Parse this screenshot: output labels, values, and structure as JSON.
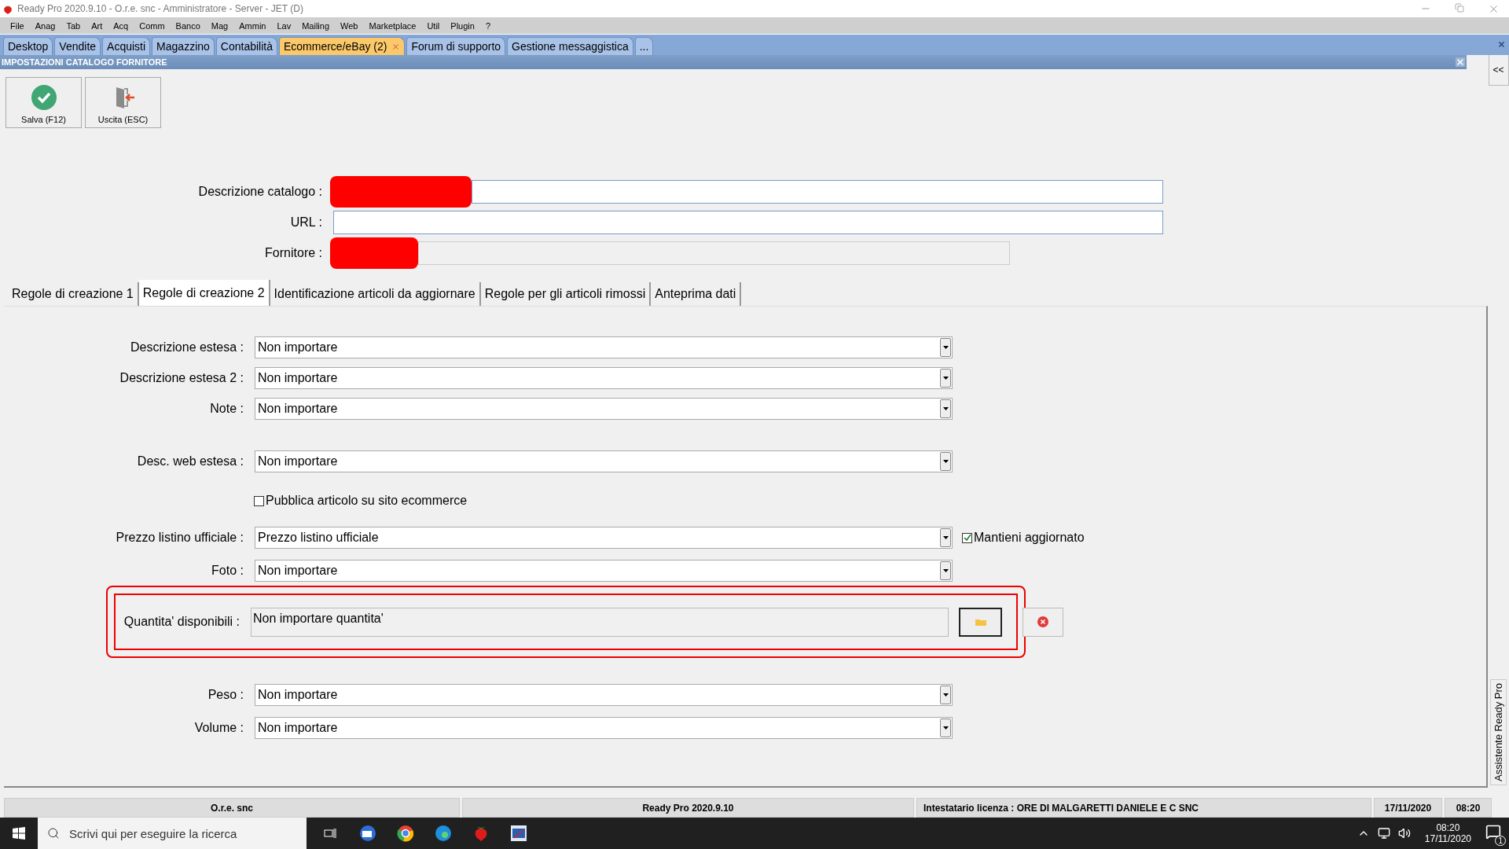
{
  "window": {
    "title": "Ready Pro 2020.9.10 - O.r.e. snc - Amministratore - Server - JET (D)"
  },
  "menu": [
    "File",
    "Anag",
    "Tab",
    "Art",
    "Acq",
    "Comm",
    "Banco",
    "Mag",
    "Ammin",
    "Lav",
    "Mailing",
    "Web",
    "Marketplace",
    "Util",
    "Plugin",
    "?"
  ],
  "app_tabs": [
    {
      "label": "Desktop",
      "selected": false,
      "closable": false
    },
    {
      "label": "Vendite",
      "selected": false,
      "closable": false
    },
    {
      "label": "Acquisti",
      "selected": false,
      "closable": false
    },
    {
      "label": "Magazzino",
      "selected": false,
      "closable": false
    },
    {
      "label": "Contabilità",
      "selected": false,
      "closable": false
    },
    {
      "label": "Ecommerce/eBay (2)",
      "selected": true,
      "closable": true
    },
    {
      "label": "Forum di supporto",
      "selected": false,
      "closable": false
    },
    {
      "label": "Gestione messaggistica",
      "selected": false,
      "closable": false
    },
    {
      "label": "...",
      "selected": false,
      "closable": false
    }
  ],
  "section": {
    "title": "IMPOSTAZIONI CATALOGO FORNITORE"
  },
  "toolbar": [
    {
      "kind": "save",
      "label": "Salva (F12)"
    },
    {
      "kind": "exit",
      "label": "Uscita (ESC)"
    }
  ],
  "header_fields": [
    {
      "kind": "text",
      "label": "Descrizione catalogo :",
      "redacted": true
    },
    {
      "kind": "text",
      "label": "URL :",
      "redacted": false
    },
    {
      "kind": "readonly",
      "label": "Fornitore :",
      "redacted": true
    }
  ],
  "tabs": [
    {
      "label": "Regole di creazione 1",
      "selected": false
    },
    {
      "label": "Regole di creazione 2",
      "selected": true
    },
    {
      "label": "Identificazione articoli da aggiornare",
      "selected": false
    },
    {
      "label": "Regole per gli articoli rimossi",
      "selected": false
    },
    {
      "label": "Anteprima dati",
      "selected": false
    }
  ],
  "rows": [
    {
      "kind": "combo",
      "label": "Descrizione estesa :",
      "value": "Non importare"
    },
    {
      "kind": "combo",
      "label": "Descrizione estesa 2 :",
      "value": "Non importare"
    },
    {
      "kind": "combo",
      "label": "Note :",
      "value": "Non importare"
    },
    {
      "kind": "combo",
      "label": "Desc. web estesa :",
      "value": "Non importare"
    },
    {
      "kind": "checkbox",
      "label": "Pubblica articolo su sito ecommerce",
      "checked": false
    },
    {
      "kind": "combo",
      "label": "Prezzo listino ufficiale :",
      "value": "Prezzo listino ufficiale",
      "option": {
        "label": "Mantieni aggiornato",
        "checked": true
      }
    },
    {
      "kind": "combo",
      "label": "Foto :",
      "value": "Non importare"
    },
    {
      "kind": "picker",
      "label": "Quantita' disponibili :",
      "value": "Non importare quantita'",
      "highlighted": true
    },
    {
      "kind": "combo",
      "label": "Peso :",
      "value": "Non importare"
    },
    {
      "kind": "combo",
      "label": "Volume :",
      "value": "Non importare"
    }
  ],
  "sidebar": {
    "collapse": "<<",
    "label": "Assistente Ready Pro"
  },
  "status_bar": [
    "O.r.e. snc",
    "Ready Pro 2020.9.10",
    "Intestatario licenza : ORE DI MALGARETTI DANIELE E C SNC",
    "17/11/2020",
    "08:20"
  ],
  "taskbar": {
    "search_placeholder": "Scrivi qui per eseguire la ricerca",
    "time": "08:20",
    "date": "17/11/2020",
    "notifications": "1"
  }
}
